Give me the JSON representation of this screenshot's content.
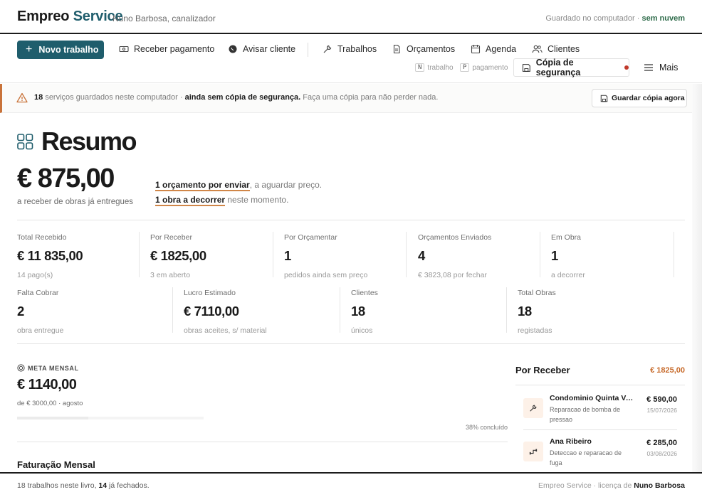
{
  "header": {
    "brand_part1": "Empreo",
    "brand_part2": "Service",
    "owner": "Nuno Barbosa, canalizador",
    "saved_prefix": "Guardado no computador ·",
    "saved_status": "sem nuvem"
  },
  "nav": {
    "new_job": "Novo trabalho",
    "receive_payment": "Receber pagamento",
    "notify_client": "Avisar cliente",
    "jobs": "Trabalhos",
    "quotes": "Orçamentos",
    "schedule": "Agenda",
    "clients": "Clientes",
    "shortcut_n_key": "N",
    "shortcut_n_label": "trabalho",
    "shortcut_p_key": "P",
    "shortcut_p_label": "pagamento",
    "backup": "Cópia de segurança",
    "more": "Mais"
  },
  "warning": {
    "count": "18",
    "text1": "serviços guardados neste computador ·",
    "bold": "ainda sem cópia de segurança.",
    "text2": "Faça uma cópia para não perder nada.",
    "button": "Guardar cópia agora"
  },
  "summary": {
    "title": "Resumo",
    "receivable": "€ 875,00",
    "receivable_sub": "a receber de obras já entregues",
    "note1_link": "1 orçamento por enviar",
    "note1_rest": ", a aguardar preço.",
    "note2_link": "1 obra a decorrer",
    "note2_rest": " neste momento."
  },
  "stats_row1": [
    {
      "label": "Total Recebido",
      "value": "€ 11 835,00",
      "sub": "14 pago(s)"
    },
    {
      "label": "Por Receber",
      "value": "€ 1825,00",
      "sub": "3 em aberto"
    },
    {
      "label": "Por Orçamentar",
      "value": "1",
      "sub": "pedidos ainda sem preço"
    },
    {
      "label": "Orçamentos Enviados",
      "value": "4",
      "sub": "€ 3823,08 por fechar"
    },
    {
      "label": "Em Obra",
      "value": "1",
      "sub": "a decorrer"
    }
  ],
  "stats_row2": [
    {
      "label": "Falta Cobrar",
      "value": "2",
      "sub": "obra entregue"
    },
    {
      "label": "Lucro Estimado",
      "value": "€ 7110,00",
      "sub": "obras aceites, s/ material"
    },
    {
      "label": "Clientes",
      "value": "18",
      "sub": "únicos"
    },
    {
      "label": "Total Obras",
      "value": "18",
      "sub": "registadas"
    }
  ],
  "goal": {
    "label": "META MENSAL",
    "value": "€ 1140,00",
    "sub": "de € 3000,00 · agosto",
    "progress_percent": 38,
    "progress_text": "38% concluído"
  },
  "billing": {
    "title": "Faturação Mensal"
  },
  "receivables": {
    "title": "Por Receber",
    "total": "€ 1825,00",
    "items": [
      {
        "name": "Condominio Quinta Verde",
        "desc": "Reparacao de bomba de pressao",
        "amount": "€ 590,00",
        "date": "15/07/2026",
        "icon": "wrench-icon"
      },
      {
        "name": "Ana Ribeiro",
        "desc": "Deteccao e reparacao de fuga",
        "amount": "€ 285,00",
        "date": "03/08/2026",
        "icon": "pipe-icon"
      }
    ]
  },
  "footer": {
    "jobs_count": "18",
    "jobs_text": "trabalhos neste livro,",
    "closed_count": "14",
    "closed_text": "já fechados.",
    "license_text": "Empreo Service · licença de",
    "license_owner": "Nuno Barbosa"
  },
  "colors": {
    "accent": "#1f5d6c",
    "warning": "#c9733a",
    "amount": "#c76a2a"
  }
}
